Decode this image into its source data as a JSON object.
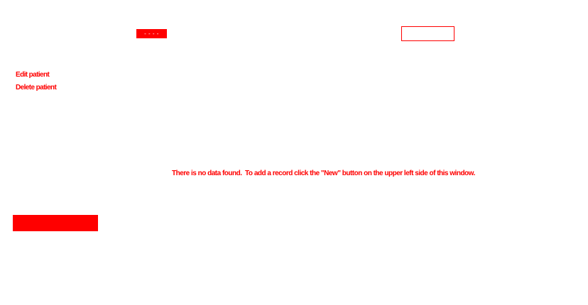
{
  "colors": {
    "accent": "#ff0000",
    "background": "#ffffff"
  },
  "toolbar": {
    "chip_label": "- - - -"
  },
  "sidebar": {
    "items": [
      {
        "label": "Edit patient"
      },
      {
        "label": "Delete patient"
      }
    ]
  },
  "main": {
    "empty_message": "There is no data found.  To add a record click the \"New\" button on the upper left side of this window."
  }
}
